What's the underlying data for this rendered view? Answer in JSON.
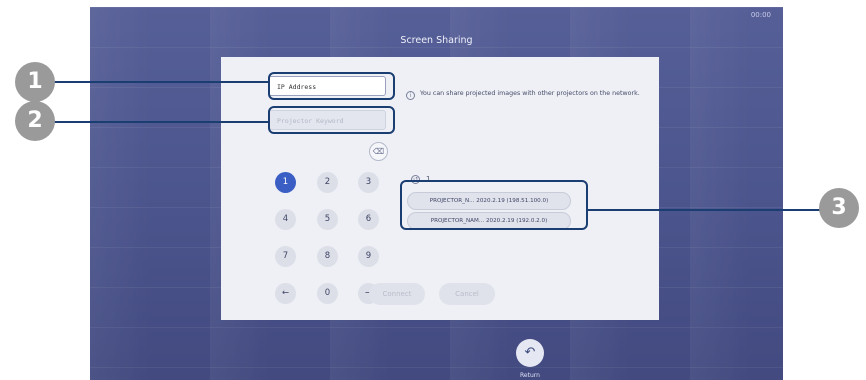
{
  "screen": {
    "clock": "00:00",
    "title": "Screen Sharing"
  },
  "form": {
    "ip_placeholder": "IP Address",
    "keyword_placeholder": "Projector Keyword"
  },
  "keypad": {
    "keys": [
      "1",
      "2",
      "3",
      "4",
      "5",
      "6",
      "7",
      "8",
      "9",
      "←",
      "0",
      "→"
    ],
    "active_key": "1",
    "backspace_icon": "backspace-icon"
  },
  "info": {
    "icon": "info-icon",
    "text": "You can share projected images with other projectors on the network."
  },
  "history": {
    "icon": "history-icon",
    "count": "1",
    "items": [
      {
        "name": "PROJECTOR_N...",
        "date": "2020.2.19",
        "ip": "(198.51.100.0)"
      },
      {
        "name": "PROJECTOR_NAM...",
        "date": "2020.2.19",
        "ip": "(192.0.2.0)"
      }
    ]
  },
  "actions": {
    "connect": "Connect",
    "cancel": "Cancel"
  },
  "footer": {
    "return_label": "Return",
    "return_icon": "return-icon"
  },
  "callouts": [
    "1",
    "2",
    "3"
  ],
  "colors": {
    "screen_bg": "#4b548c",
    "panel_bg": "#eef0f6",
    "active_key": "#3b5ec4",
    "callout_line": "#1b3e72",
    "callout_badge": "#9a9a9a"
  }
}
